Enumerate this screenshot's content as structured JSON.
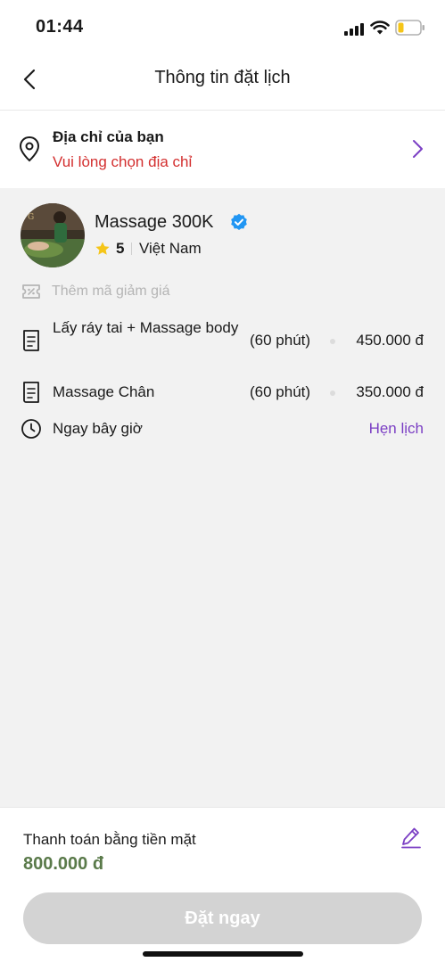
{
  "status_bar": {
    "time": "01:44"
  },
  "header": {
    "title": "Thông tin đặt lịch"
  },
  "address": {
    "title": "Địa chỉ của bạn",
    "warning": "Vui lòng chọn địa chỉ"
  },
  "shop": {
    "name": "Massage 300K",
    "rating": "5",
    "country": "Việt Nam"
  },
  "coupon": {
    "label": "Thêm mã giảm giá"
  },
  "services": [
    {
      "name": "Lấy ráy tai + Massage body",
      "duration": "(60 phút)",
      "price": "450.000 đ"
    },
    {
      "name": "Massage Chân",
      "duration": "(60 phút)",
      "price": "350.000 đ"
    }
  ],
  "time": {
    "label": "Ngay bây giờ",
    "schedule_link": "Hẹn lịch"
  },
  "payment": {
    "method": "Thanh toán bằng tiền mặt",
    "total": "800.000 đ",
    "button": "Đặt ngay"
  },
  "colors": {
    "accent": "#7b3fc4",
    "warning": "#d32f2f",
    "price_green": "#5a7a4a",
    "verified": "#2196f3",
    "star": "#f5c518",
    "disabled_button": "#d3d3d3"
  }
}
